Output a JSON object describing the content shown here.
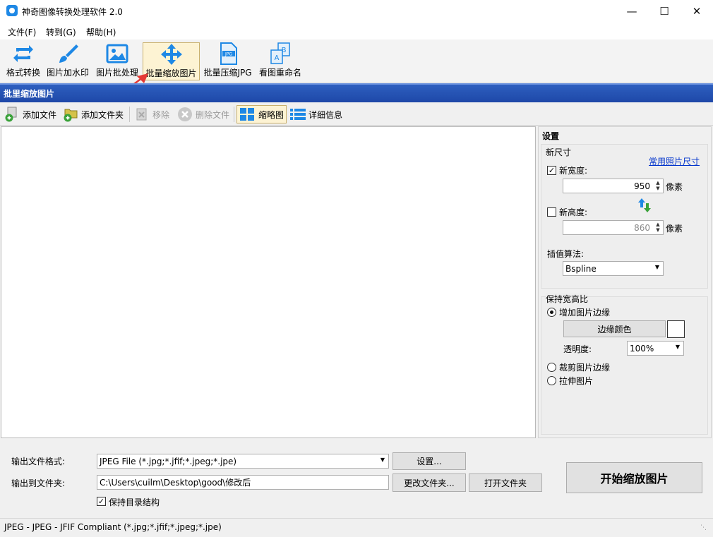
{
  "window": {
    "title": "神奇图像转换处理软件 2.0"
  },
  "menu": [
    "文件(F)",
    "转到(G)",
    "帮助(H)"
  ],
  "ribbon": {
    "items": [
      {
        "label": "格式转换",
        "icon": "rotate-arrows-icon"
      },
      {
        "label": "图片加水印",
        "icon": "brush-icon"
      },
      {
        "label": "图片批处理",
        "icon": "image-icon"
      },
      {
        "label": "批量缩放图片",
        "icon": "move-arrows-icon",
        "active": true
      },
      {
        "label": "批量压缩JPG",
        "icon": "jpg-file-icon"
      },
      {
        "label": "看图重命名",
        "icon": "rename-icon"
      }
    ]
  },
  "section": {
    "title": "批里缩放图片"
  },
  "toolbar2": {
    "add_file": "添加文件",
    "add_folder": "添加文件夹",
    "remove": "移除",
    "delete_file": "删除文件",
    "thumbnail": "缩略图",
    "details": "详细信息"
  },
  "settings": {
    "title": "设置",
    "new_size": {
      "label": "新尺寸",
      "common_sizes_link": "常用照片尺寸",
      "width_label": "新宽度:",
      "width_checked": true,
      "width_value": "950",
      "height_label": "新高度:",
      "height_checked": false,
      "height_value": "860",
      "unit": "像素",
      "interpolation_label": "插值算法:",
      "interpolation_value": "Bspline"
    },
    "aspect": {
      "label": "保持宽高比",
      "add_border": "增加图片边缘",
      "border_color_button": "边缘颜色",
      "border_color": "#ffffff",
      "transparency_label": "透明度:",
      "transparency_value": "100%",
      "crop": "裁剪图片边缘",
      "stretch": "拉伸图片",
      "selected": "add_border"
    }
  },
  "bottom": {
    "format_label": "输出文件格式:",
    "format_value": "JPEG File (*.jpg;*.jfif;*.jpeg;*.jpe)",
    "settings_button": "设置...",
    "output_label": "输出到文件夹:",
    "output_value": "C:\\Users\\cuilm\\Desktop\\good\\修改后",
    "change_folder_button": "更改文件夹...",
    "open_folder_button": "打开文件夹",
    "keep_structure_label": "保持目录结构",
    "keep_structure_checked": true,
    "start_button": "开始缩放图片"
  },
  "status": {
    "text": "JPEG - JPEG - JFIF Compliant (*.jpg;*.jfif;*.jpeg;*.jpe)"
  }
}
